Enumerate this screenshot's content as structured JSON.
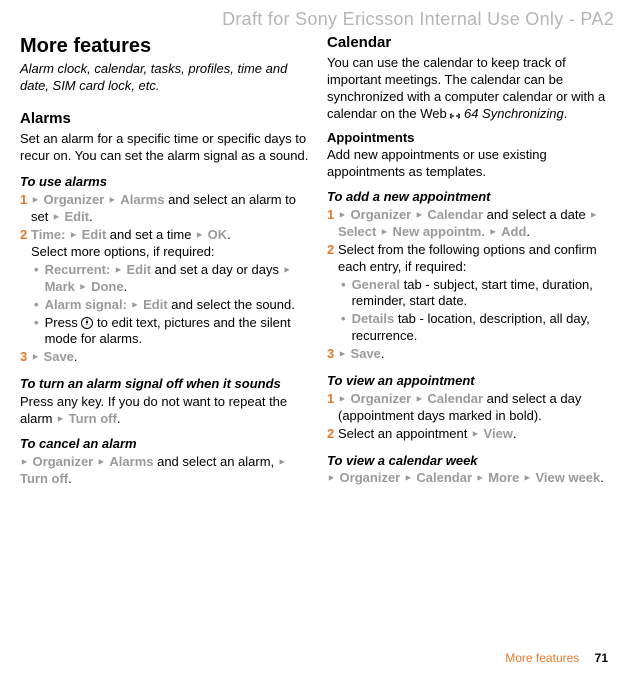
{
  "draft_header": "Draft for Sony Ericsson Internal Use Only - PA2",
  "left": {
    "h1": "More features",
    "h1_sub": "Alarm clock, calendar, tasks, profiles, time and date, SIM card lock, etc.",
    "alarms_h": "Alarms",
    "alarms_body": "Set an alarm for a specific time or specific days to recur on. You can set the alarm signal as a sound.",
    "use_alarms_h": "To use alarms",
    "ua_s1_pre": "",
    "ua_s1_k1": "Organizer",
    "ua_s1_k2": "Alarms",
    "ua_s1_mid": " and select an alarm to set ",
    "ua_s1_k3": "Edit",
    "ua_s2_k1": "Time:",
    "ua_s2_k2": "Edit",
    "ua_s2_mid": " and set a time ",
    "ua_s2_k3": "OK",
    "ua_more": "Select more options, if required:",
    "ua_b1_k1": "Recurrent:",
    "ua_b1_k2": "Edit",
    "ua_b1_mid": " and set a day or days ",
    "ua_b1_k3": "Mark",
    "ua_b1_k4": "Done",
    "ua_b2_k1": "Alarm signal:",
    "ua_b2_k2": "Edit",
    "ua_b2_mid": " and select the sound.",
    "ua_b3_pre": "Press ",
    "ua_b3_post": " to edit text, pictures and the silent mode for alarms.",
    "ua_s3_k1": "Save",
    "off_h": "To turn an alarm signal off when it sounds",
    "off_body_pre": "Press any key. If you do not want to repeat the alarm ",
    "off_k1": "Turn off",
    "cancel_h": "To cancel an alarm",
    "cancel_k1": "Organizer",
    "cancel_k2": "Alarms",
    "cancel_mid": " and select an alarm, ",
    "cancel_k3": "Turn off"
  },
  "right": {
    "cal_h": "Calendar",
    "cal_body_pre": "You can use the calendar to keep track of important meetings. The calendar can be synchronized with a computer calendar or with a calendar on the Web ",
    "cal_ref": "64 Synchronizing",
    "appt_h": "Appointments",
    "appt_body": "Add new appointments or use existing appointments as templates.",
    "add_h": "To add a new appointment",
    "add_s1_k1": "Organizer",
    "add_s1_k2": "Calendar",
    "add_s1_mid": " and select a date ",
    "add_s1_k3": "Select",
    "add_s1_k4": "New appointm.",
    "add_s1_k5": "Add",
    "add_s2": "Select from the following options and confirm each entry, if required:",
    "add_b1_k1": "General",
    "add_b1_post": " tab - subject, start time, duration, reminder, start date.",
    "add_b2_k1": "Details",
    "add_b2_post": " tab - location, description, all day, recurrence.",
    "add_s3_k1": "Save",
    "view_h": "To view an appointment",
    "view_s1_k1": "Organizer",
    "view_s1_k2": "Calendar",
    "view_s1_mid": " and select a day (appointment days marked in bold).",
    "view_s2_pre": "Select an appointment ",
    "view_s2_k1": "View",
    "week_h": "To view a calendar week",
    "week_k1": "Organizer",
    "week_k2": "Calendar",
    "week_k3": "More",
    "week_k4": "View week"
  },
  "footer_section": "More features",
  "footer_page": "71",
  "steps": {
    "n1": "1",
    "n2": "2",
    "n3": "3"
  },
  "bullet": "•",
  "arrow": "►"
}
